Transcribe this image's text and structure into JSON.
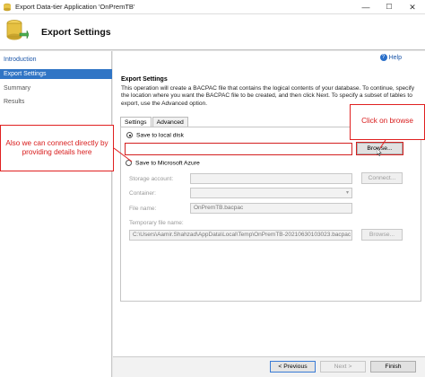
{
  "window": {
    "title": "Export Data-tier Application 'OnPremTB'",
    "minimize": "—",
    "maximize": "☐",
    "close": "✕"
  },
  "header": {
    "title": "Export Settings"
  },
  "sidebar": {
    "items": [
      {
        "label": "Introduction",
        "state": "link"
      },
      {
        "label": "Export Settings",
        "state": "active"
      },
      {
        "label": "Summary",
        "state": "normal"
      },
      {
        "label": "Results",
        "state": "normal"
      }
    ]
  },
  "main": {
    "help_label": "Help",
    "section_title": "Export Settings",
    "description": "This operation will create a BACPAC file that contains the logical contents of your database. To continue, specify the location where you want the BACPAC file to be created, and then click Next. To specify a subset of tables to export, use the Advanced option.",
    "tabs": [
      {
        "label": "Settings",
        "active": true
      },
      {
        "label": "Advanced",
        "active": false
      }
    ],
    "save_local_label": "Save to local disk",
    "local_path_value": "",
    "browse_label": "Browse...",
    "save_azure_label": "Save to Microsoft Azure",
    "storage_account_label": "Storage account:",
    "storage_account_value": "",
    "connect_label": "Connect...",
    "container_label": "Container:",
    "container_value": "",
    "file_name_label": "File name:",
    "file_name_value": "OnPremTB.bacpac",
    "temp_file_label": "Temporary file name:",
    "temp_file_value": "C:\\Users\\Aamir.Shahzad\\AppData\\Local\\Temp\\OnPremTB-20210630103023.bacpac",
    "temp_browse_label": "Browse..."
  },
  "footer": {
    "previous_label": "< Previous",
    "next_label": "Next >",
    "finish_label": "Finish"
  },
  "annotations": {
    "left_callout": "Also we can connect directly by providing details here",
    "right_callout": "Click on browse"
  },
  "colors": {
    "accent": "#3075c5",
    "annotation_red": "#e02020"
  }
}
